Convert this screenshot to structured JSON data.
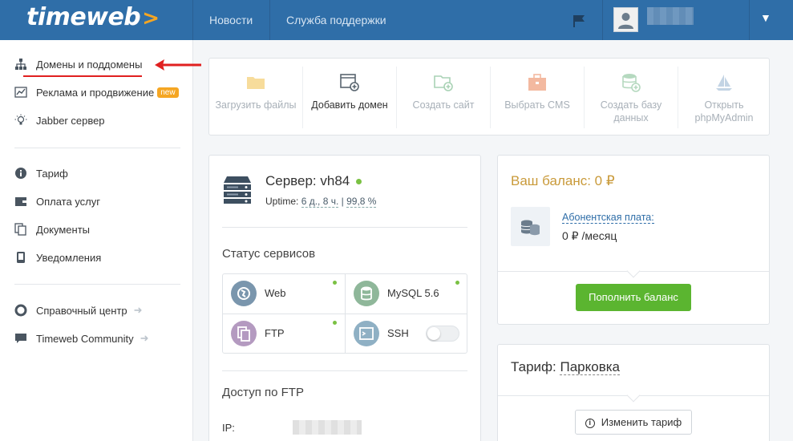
{
  "header": {
    "logo": "timeweb",
    "logo_arrow": ">",
    "nav": [
      "Новости",
      "Служба поддержки"
    ],
    "caret": "▼"
  },
  "sidebar": {
    "items_top": [
      {
        "label": "Домены и поддомены",
        "icon": "sitemap-icon"
      },
      {
        "label": "Реклама и продвижение",
        "icon": "chart-icon",
        "badge": "new"
      },
      {
        "label": "Jabber сервер",
        "icon": "lightbulb-icon"
      }
    ],
    "items_mid": [
      {
        "label": "Тариф",
        "icon": "info-icon"
      },
      {
        "label": "Оплата услуг",
        "icon": "wallet-icon"
      },
      {
        "label": "Документы",
        "icon": "documents-icon"
      },
      {
        "label": "Уведомления",
        "icon": "phone-icon"
      }
    ],
    "items_bottom": [
      {
        "label": "Справочный центр",
        "icon": "help-icon"
      },
      {
        "label": "Timeweb Community",
        "icon": "chat-icon"
      }
    ]
  },
  "quick_actions": [
    {
      "label": "Загрузить файлы",
      "icon": "folder-icon",
      "active": false
    },
    {
      "label": "Добавить домен",
      "icon": "add-domain-icon",
      "active": true
    },
    {
      "label": "Создать сайт",
      "icon": "folder-plus-icon",
      "active": false
    },
    {
      "label": "Выбрать CMS",
      "icon": "briefcase-icon",
      "active": false
    },
    {
      "label": "Создать базу данных",
      "icon": "database-plus-icon",
      "active": false
    },
    {
      "label": "Открыть phpMyAdmin",
      "icon": "sailboat-icon",
      "active": false
    }
  ],
  "server": {
    "title": "Сервер: vh84",
    "uptime_label": "Uptime:",
    "uptime_value": "6 д., 8 ч.",
    "uptime_sep": "|",
    "uptime_percent": "99,8 %",
    "status_title": "Статус сервисов",
    "services": [
      {
        "label": "Web",
        "icon": "globe-icon",
        "color": "#7a96ad",
        "online": true
      },
      {
        "label": "MySQL 5.6",
        "icon": "database-icon",
        "color": "#8fb79a",
        "online": true
      },
      {
        "label": "FTP",
        "icon": "ftp-icon",
        "color": "#b49ac0",
        "online": true
      },
      {
        "label": "SSH",
        "icon": "terminal-icon",
        "color": "#8fb0c4",
        "online": false
      }
    ],
    "ftp_title": "Доступ по FTP",
    "ip_label": "IP:"
  },
  "balance": {
    "title": "Ваш баланс: 0 ₽",
    "fee_label": "Абонентская плата:",
    "fee_value": "0 ₽ /месяц",
    "topup_button": "Пополнить баланс"
  },
  "tariff": {
    "prefix": "Тариф:",
    "name": "Парковка",
    "change_button": "Изменить тариф",
    "info_glyph": "i"
  },
  "colors": {
    "header_bg": "#2f6ea8",
    "accent_orange": "#f5a623",
    "green": "#5bb530",
    "balance_gold": "#c99a3a",
    "annotation_red": "#e02020"
  }
}
